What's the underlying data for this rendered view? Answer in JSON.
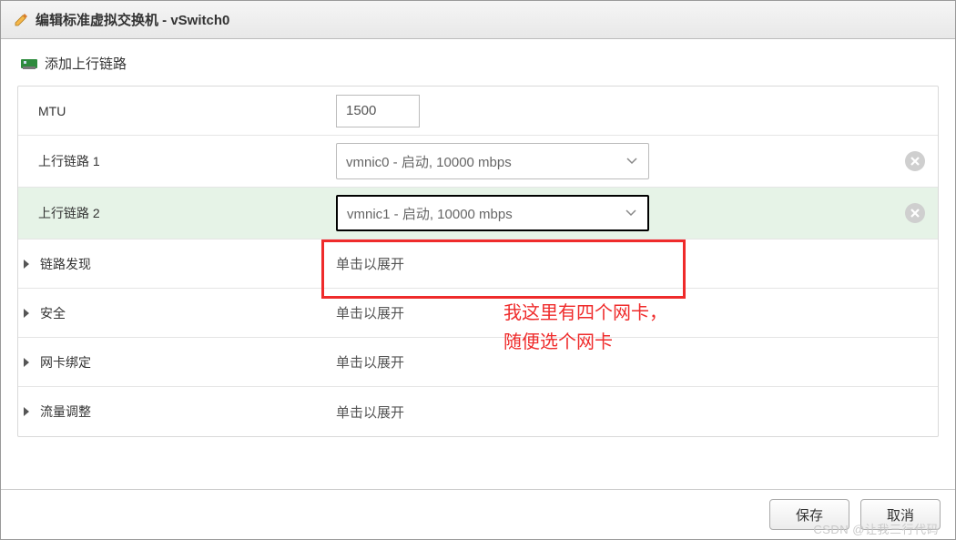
{
  "dialog": {
    "title": "编辑标准虚拟交换机 - vSwitch0"
  },
  "addUplink": {
    "label": "添加上行链路"
  },
  "rows": {
    "mtu": {
      "label": "MTU",
      "value": "1500"
    },
    "uplink1": {
      "label": "上行链路 1",
      "selected": "vmnic0 - 启动, 10000 mbps"
    },
    "uplink2": {
      "label": "上行链路 2",
      "selected": "vmnic1 - 启动, 10000 mbps"
    },
    "linkDiscovery": {
      "label": "链路发现",
      "hint": "单击以展开"
    },
    "security": {
      "label": "安全",
      "hint": "单击以展开"
    },
    "nicTeaming": {
      "label": "网卡绑定",
      "hint": "单击以展开"
    },
    "trafficShaping": {
      "label": "流量调整",
      "hint": "单击以展开"
    }
  },
  "annotation": {
    "line1": "我这里有四个网卡，",
    "line2": "随便选个网卡"
  },
  "footer": {
    "save": "保存",
    "cancel": "取消"
  },
  "watermark": "CSDN @让我三行代码"
}
